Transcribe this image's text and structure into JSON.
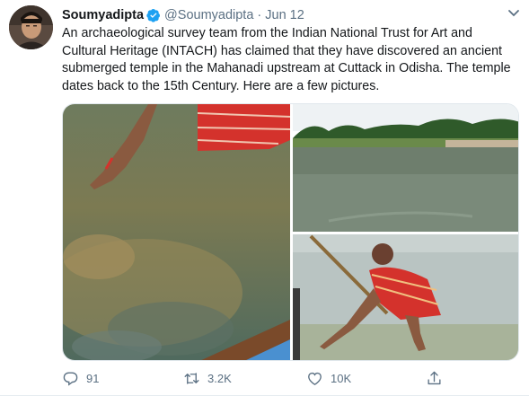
{
  "tweet": {
    "author_name": "Soumyadipta",
    "handle": "@Soumyadipta",
    "separator": "·",
    "date": "Jun 12",
    "text": "An archaeological survey team from the Indian National Trust for Art and Cultural Heritage (INTACH) has claimed that they have discovered an ancient submerged temple in the Mahanadi upstream at Cuttack in Odisha. The temple dates back to the 15th Century. Here are a few pictures.",
    "verified": true
  },
  "media": {
    "photos": [
      {
        "description_icon": "photo-hand-in-water"
      },
      {
        "description_icon": "photo-river-landscape"
      },
      {
        "description_icon": "photo-man-with-pole"
      }
    ]
  },
  "actions": {
    "reply_count": "91",
    "retweet_count": "3.2K",
    "like_count": "10K"
  },
  "icons": {
    "verified": "verified-badge-icon",
    "caret": "chevron-down-icon",
    "reply": "reply-icon",
    "retweet": "retweet-icon",
    "like": "heart-icon",
    "share": "share-icon"
  },
  "colors": {
    "accent": "#1da1f2",
    "secondary_text": "#5b7083",
    "primary_text": "#14171a"
  }
}
